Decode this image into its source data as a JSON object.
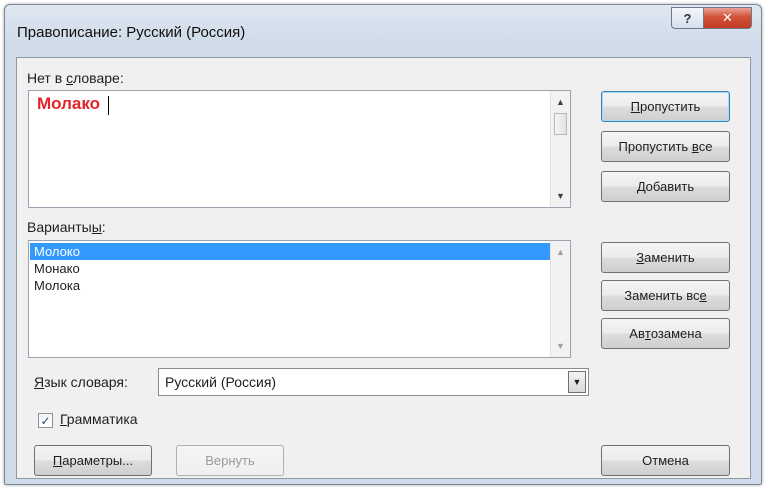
{
  "window": {
    "title": "Правописание: Русский (Россия)",
    "help_glyph": "?",
    "close_glyph": "✕"
  },
  "not_in_dictionary": {
    "label_prefix": "Нет в ",
    "label_underlined": "с",
    "label_suffix": "ловаре:",
    "word": "Молако"
  },
  "suggestions": {
    "label_prefix": "Варианты",
    "label_underlined": "ы",
    "label_suffix": ":",
    "items": [
      "Молоко",
      "Монако",
      "Молока"
    ],
    "selected_index": 0
  },
  "buttons": {
    "ignore": {
      "underlined": "П",
      "rest": "ропустить"
    },
    "ignore_all": {
      "prefix": "Пропустить ",
      "underlined": "в",
      "rest": "се"
    },
    "add": {
      "underlined": "Д",
      "rest": "обавить"
    },
    "change": {
      "underlined": "З",
      "rest": "аменить"
    },
    "change_all": {
      "prefix": "Заменить вс",
      "underlined": "е",
      "rest": ""
    },
    "autocorrect": {
      "prefix": "Ав",
      "underlined": "т",
      "rest": "озамена"
    },
    "options": {
      "underlined": "П",
      "rest": "араметры..."
    },
    "undo": "Вернуть",
    "cancel": "Отмена"
  },
  "dictionary_language": {
    "label_underlined": "Я",
    "label_rest": "зык словаря:",
    "value": "Русский (Россия)"
  },
  "grammar": {
    "checked": true,
    "label_underlined": "Г",
    "label_rest": "рамматика"
  }
}
